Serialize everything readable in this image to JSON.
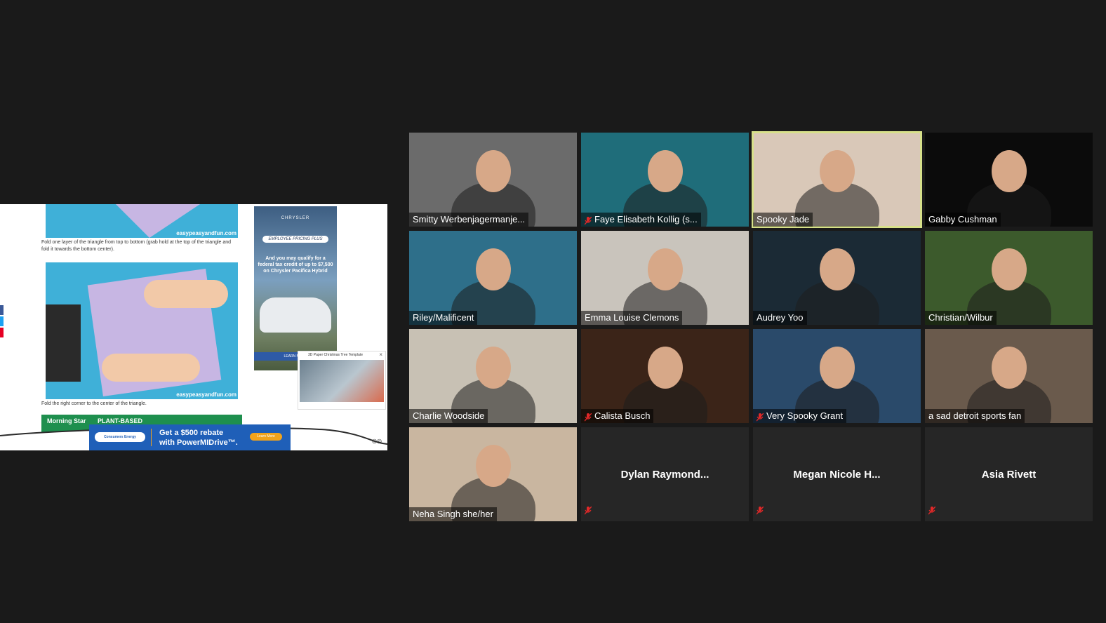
{
  "screen_share": {
    "caption_top": "Fold one layer of the triangle from top to bottom (grab hold at the top of the triangle and fold it towards the bottom center).",
    "caption_bottom": "Fold the right corner to the center of the triangle.",
    "watermark": "easypeasyandfun.com",
    "side_ad": {
      "brand": "CHRYSLER",
      "pill": "EMPLOYEE PRICING PLUS",
      "copy": "And you may qualify for a federal tax credit of up to $7,500 on Chrysler Pacifica Hybrid",
      "button": "LEARN MORE"
    },
    "video_ad": {
      "title": "3D Paper Christmas Tree Template"
    },
    "green_banner": "PLANT-BASED",
    "green_banner_brand": "Morning Star",
    "bottom_ad": {
      "logo": "Consumers Energy",
      "line1": "Get a $500 rebate",
      "line2": "with PowerMIDrive™.",
      "cta": "Learn More"
    },
    "colors": {
      "photo_bg": "#3fb0d8",
      "paper": "#c7b6e3"
    }
  },
  "participants": [
    {
      "name": "Smitty Werbenjagermanje...",
      "muted": false,
      "video": true,
      "active": false,
      "bg": "#6b6b6b"
    },
    {
      "name": "Faye Elisabeth Kollig (s...",
      "muted": true,
      "video": true,
      "active": false,
      "bg": "#1f6d7a"
    },
    {
      "name": "Spooky Jade",
      "muted": false,
      "video": true,
      "active": true,
      "bg": "#d9c8b8"
    },
    {
      "name": "Gabby Cushman",
      "muted": false,
      "video": true,
      "active": false,
      "bg": "#0b0b0b"
    },
    {
      "name": "Riley/Malificent",
      "muted": false,
      "video": true,
      "active": false,
      "bg": "#2e6f8a"
    },
    {
      "name": "Emma Louise Clemons",
      "muted": false,
      "video": true,
      "active": false,
      "bg": "#c9c4bc"
    },
    {
      "name": "Audrey Yoo",
      "muted": false,
      "video": true,
      "active": false,
      "bg": "#1b2a35"
    },
    {
      "name": "Christian/Wilbur",
      "muted": false,
      "video": true,
      "active": false,
      "bg": "#3c5a2c"
    },
    {
      "name": "Charlie Woodside",
      "muted": false,
      "video": true,
      "active": false,
      "bg": "#c8c1b4"
    },
    {
      "name": "Calista Busch",
      "muted": true,
      "video": true,
      "active": false,
      "bg": "#3b2418"
    },
    {
      "name": "Very Spooky Grant",
      "muted": true,
      "video": true,
      "active": false,
      "bg": "#2a4a6a"
    },
    {
      "name": "a sad detroit sports fan",
      "muted": false,
      "video": true,
      "active": false,
      "bg": "#6a5a4c"
    },
    {
      "name": "Neha Singh she/her",
      "muted": false,
      "video": true,
      "active": false,
      "bg": "#c9b6a0"
    },
    {
      "name": "Dylan  Raymond...",
      "muted": true,
      "video": false,
      "active": false,
      "bg": "#262626"
    },
    {
      "name": "Megan  Nicole  H...",
      "muted": true,
      "video": false,
      "active": false,
      "bg": "#262626"
    },
    {
      "name": "Asia Rivett",
      "muted": true,
      "video": false,
      "active": false,
      "bg": "#262626"
    }
  ],
  "colors": {
    "background": "#1a1a1a",
    "tile": "#262626",
    "active_border": "#d7e08a",
    "mute_red": "#e02828"
  }
}
